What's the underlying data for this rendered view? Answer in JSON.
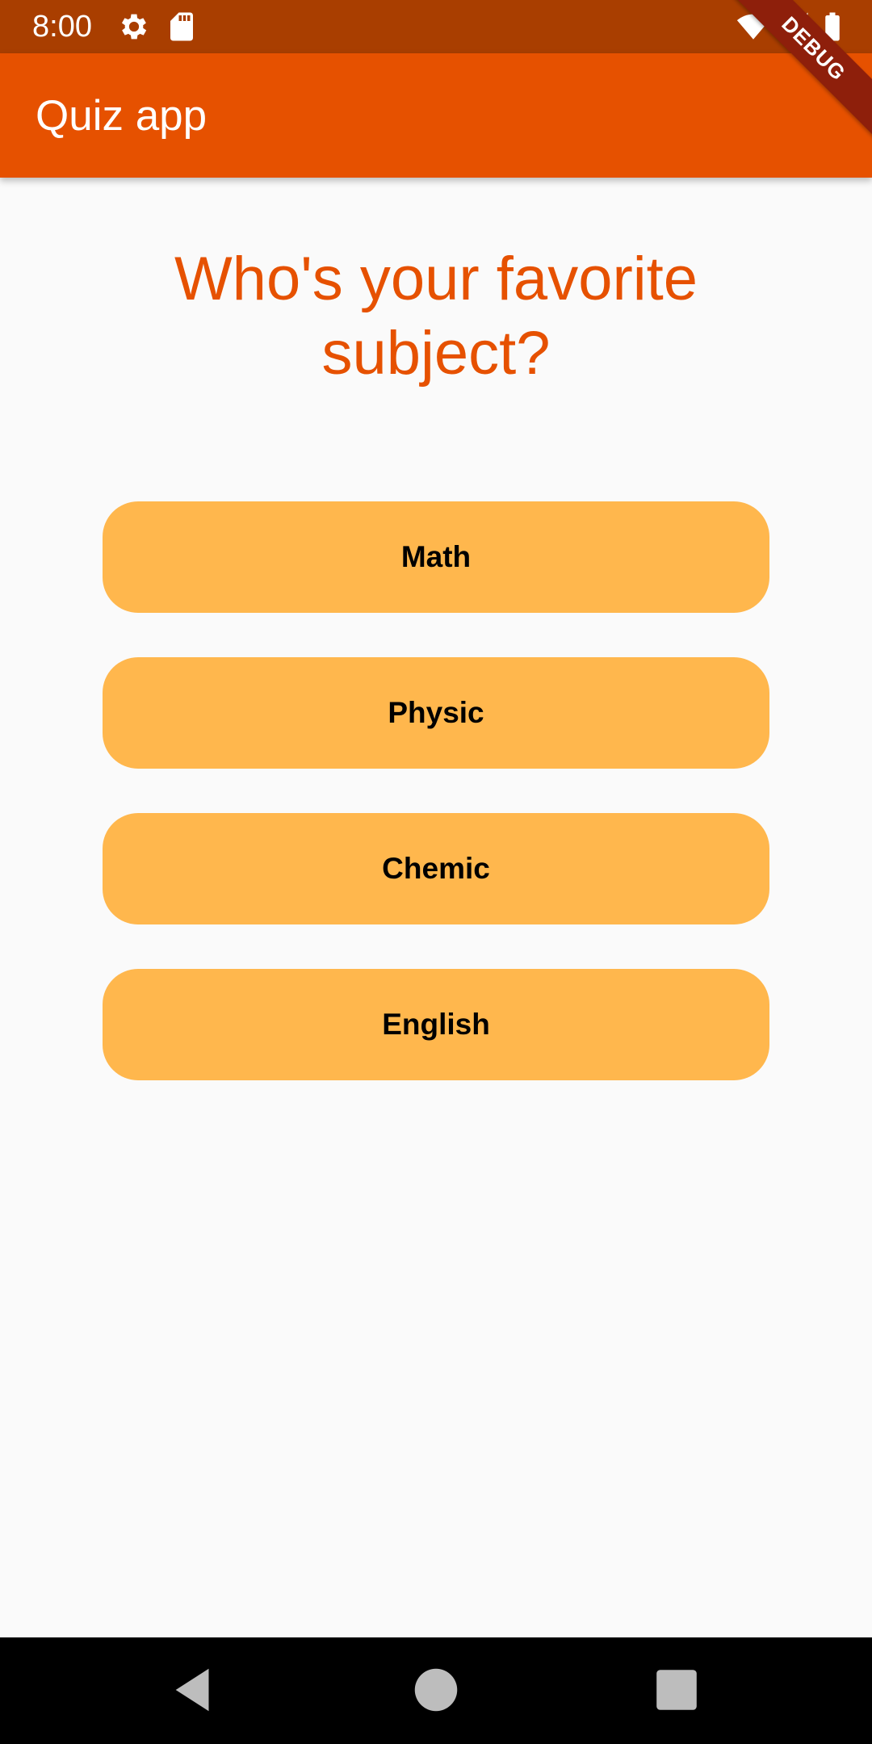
{
  "status_bar": {
    "time": "8:00",
    "icons": [
      "settings-icon",
      "sd-card-icon",
      "wifi-icon",
      "signal-icon",
      "battery-icon"
    ]
  },
  "app_bar": {
    "title": "Quiz app",
    "debug_banner": "DEBUG"
  },
  "question": {
    "text": "Who's your favorite subject?"
  },
  "answers": [
    {
      "label": "Math"
    },
    {
      "label": "Physic"
    },
    {
      "label": "Chemic"
    },
    {
      "label": "English"
    }
  ],
  "nav_bar": {
    "buttons": [
      "back-icon",
      "home-icon",
      "recents-icon"
    ]
  },
  "colors": {
    "status_bar": "#A93E00",
    "app_bar": "#E65100",
    "accent": "#E65100",
    "answer_button": "#FFB74D",
    "background": "#FAFAFA",
    "debug_banner": "#8E1F0B"
  }
}
